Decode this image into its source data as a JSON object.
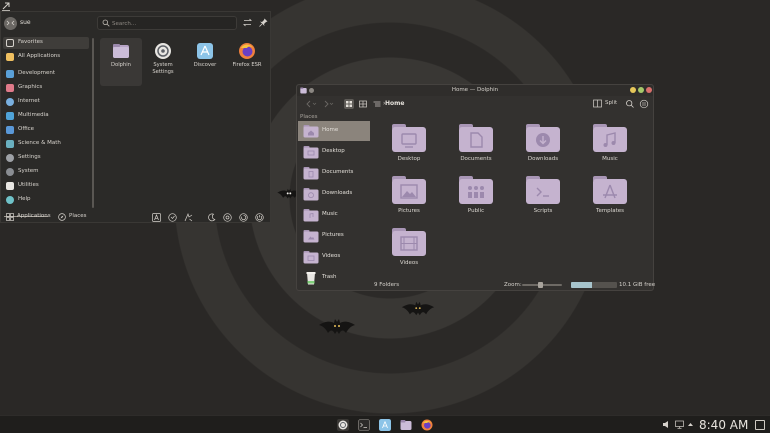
{
  "launcher": {
    "username": "sue",
    "search_placeholder": "Search…",
    "categories": [
      {
        "label": "Favorites",
        "color": "#3b3936"
      },
      {
        "label": "All Applications",
        "color": "#f0c060"
      },
      {
        "label": "Development",
        "color": "#5aa0d8"
      },
      {
        "label": "Graphics",
        "color": "#e07a8a"
      },
      {
        "label": "Internet",
        "color": "#7ab0e0"
      },
      {
        "label": "Multimedia",
        "color": "#4fa3d8"
      },
      {
        "label": "Office",
        "color": "#5a98d8"
      },
      {
        "label": "Science & Math",
        "color": "#6ab0c0"
      },
      {
        "label": "Settings",
        "color": "#9ea1a6"
      },
      {
        "label": "System",
        "color": "#8a8d92"
      },
      {
        "label": "Utilities",
        "color": "#e8e6e2"
      },
      {
        "label": "Help",
        "color": "#6fc2c8"
      }
    ],
    "favorites": [
      {
        "label": "Dolphin",
        "icon": "dolphin-icon"
      },
      {
        "label": "System Settings",
        "icon": "settings-icon"
      },
      {
        "label": "Discover",
        "icon": "discover-icon"
      },
      {
        "label": "Firefox ESR",
        "icon": "firefox-icon"
      }
    ],
    "footer": {
      "applications_label": "Applications",
      "places_label": "Places"
    }
  },
  "dolphin": {
    "title": "Home — Dolphin",
    "breadcrumb": "Home",
    "split_label": "Split",
    "places_header": "Places",
    "places": [
      {
        "label": "Home"
      },
      {
        "label": "Desktop"
      },
      {
        "label": "Documents"
      },
      {
        "label": "Downloads"
      },
      {
        "label": "Music"
      },
      {
        "label": "Pictures"
      },
      {
        "label": "Videos"
      },
      {
        "label": "Trash"
      }
    ],
    "files": [
      {
        "label": "Desktop",
        "icon": "desktop-folder-icon"
      },
      {
        "label": "Documents",
        "icon": "documents-folder-icon"
      },
      {
        "label": "Downloads",
        "icon": "downloads-folder-icon"
      },
      {
        "label": "Music",
        "icon": "music-folder-icon"
      },
      {
        "label": "Pictures",
        "icon": "pictures-folder-icon"
      },
      {
        "label": "Public",
        "icon": "public-folder-icon"
      },
      {
        "label": "Scripts",
        "icon": "scripts-folder-icon"
      },
      {
        "label": "Templates",
        "icon": "templates-folder-icon"
      },
      {
        "label": "Videos",
        "icon": "videos-folder-icon"
      }
    ],
    "status": {
      "folder_count": "9 Folders",
      "zoom_label": "Zoom:",
      "zoom_level": 0.45,
      "disk_used_fraction": 0.45,
      "disk_free": "10.1 GiB free"
    },
    "colors": {
      "folder": "#c5b3cf",
      "folder_dark": "#a996b6",
      "accent": "#8b847c"
    }
  },
  "panel": {
    "clock": "8:40 AM"
  }
}
